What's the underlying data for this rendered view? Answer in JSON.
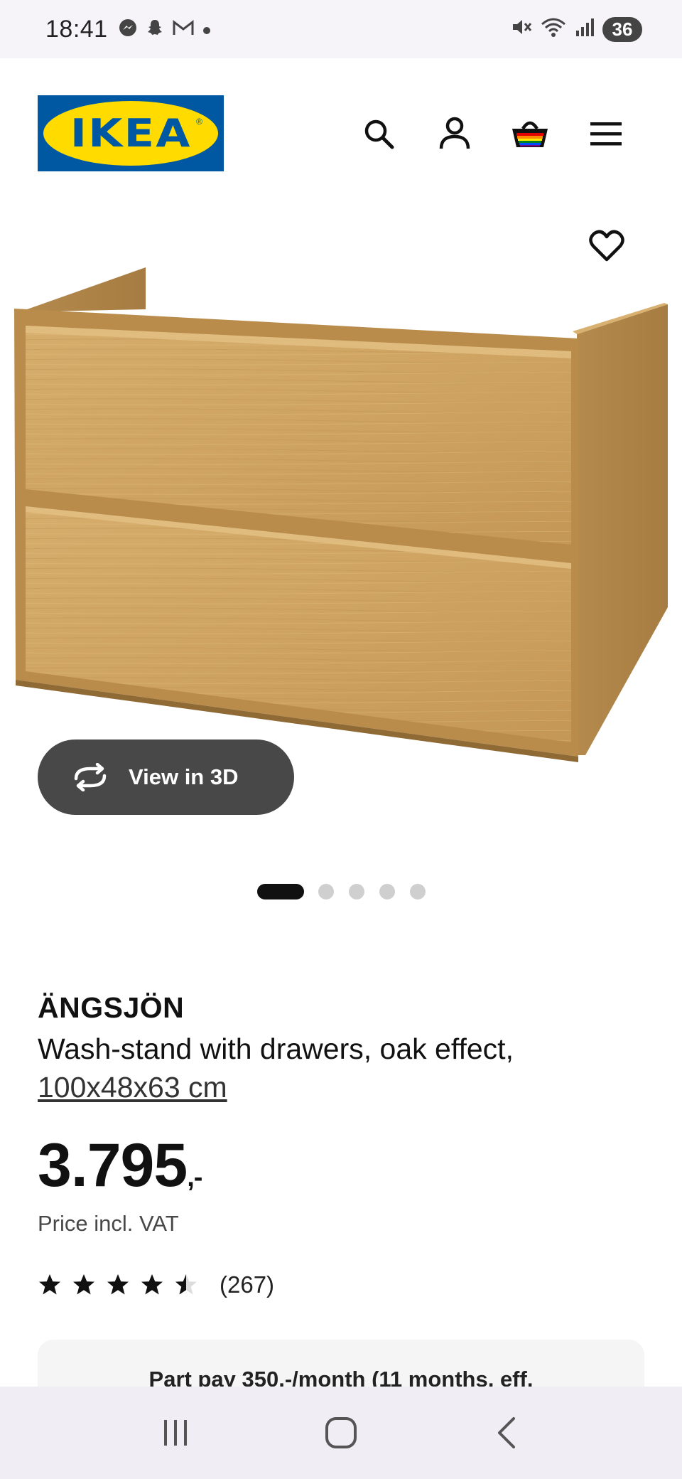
{
  "status_bar": {
    "time": "18:41",
    "battery": "36",
    "notification_icons": [
      "messenger-icon",
      "snapchat-icon",
      "gmail-icon",
      "dot-icon"
    ],
    "system_icons": [
      "mute-icon",
      "wifi-icon",
      "signal-icon"
    ]
  },
  "header": {
    "logo_text": "IKEA",
    "logo_colors": {
      "blue": "#0058a3",
      "yellow": "#ffdb00"
    },
    "icons": [
      "search-icon",
      "account-icon",
      "basket-icon",
      "menu-icon"
    ]
  },
  "product": {
    "image_alt": "oak wash-stand",
    "view_3d_label": "View in 3D",
    "carousel": {
      "total": 5,
      "active": 0
    },
    "name": "ÄNGSJÖN",
    "description_line1": "Wash-stand with drawers, oak effect,",
    "description_line2": "100x48x63 cm",
    "price_main": "3.795",
    "price_suffix": ",-",
    "price_note": "Price incl. VAT",
    "rating": {
      "value": 4.5,
      "max": 5
    },
    "review_count": "(267)"
  },
  "part_pay": {
    "text": "Part pay 350,-/month (11 months, eff."
  },
  "nav_bar": {
    "buttons": [
      "recents-icon",
      "home-icon",
      "back-icon"
    ]
  }
}
